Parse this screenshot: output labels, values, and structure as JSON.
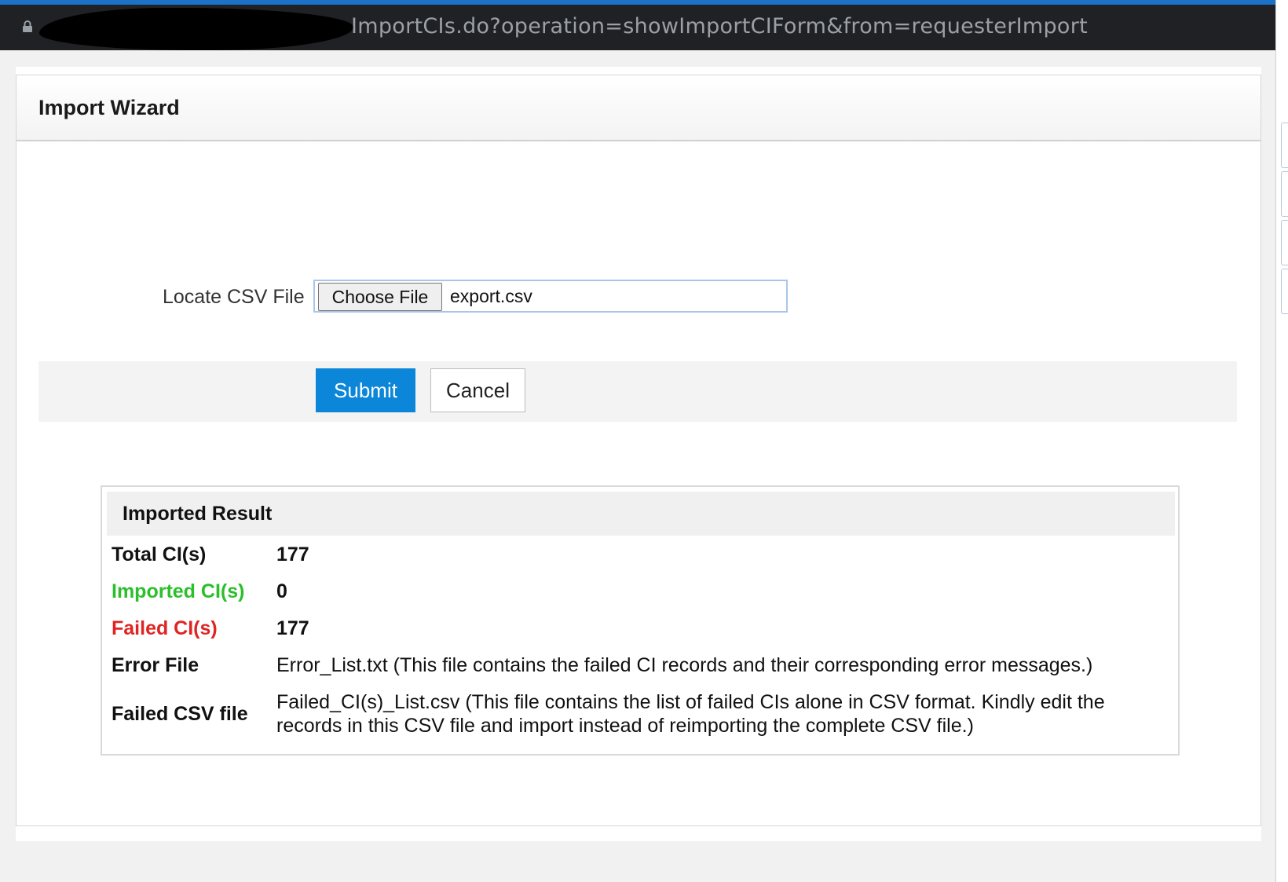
{
  "browser": {
    "url_text": "ImportCIs.do?operation=showImportCIForm&from=requesterImport"
  },
  "wizard": {
    "title": "Import Wizard",
    "locate_label": "Locate CSV File",
    "choose_file_label": "Choose File",
    "selected_file": "export.csv",
    "submit_label": "Submit",
    "cancel_label": "Cancel"
  },
  "result": {
    "title": "Imported Result",
    "total": {
      "label": "Total CI(s)",
      "value": "177"
    },
    "imported": {
      "label": "Imported CI(s)",
      "value": "0"
    },
    "failed": {
      "label": "Failed CI(s)",
      "value": "177"
    },
    "error_file": {
      "label": "Error File",
      "value": "Error_List.txt  (This file contains the failed CI records and their corresponding error messages.)"
    },
    "failed_csv": {
      "label": "Failed CSV file",
      "value_line1": "Failed_CI(s)_List.csv  (This file contains the list of failed CIs alone in CSV format. Kindly edit the",
      "value_line2": "records in this CSV file and import instead of reimporting the complete CSV file.)"
    }
  },
  "colors": {
    "accent_blue": "#0b86d8",
    "imported_green": "#2bbf2b",
    "failed_red": "#e02424"
  }
}
